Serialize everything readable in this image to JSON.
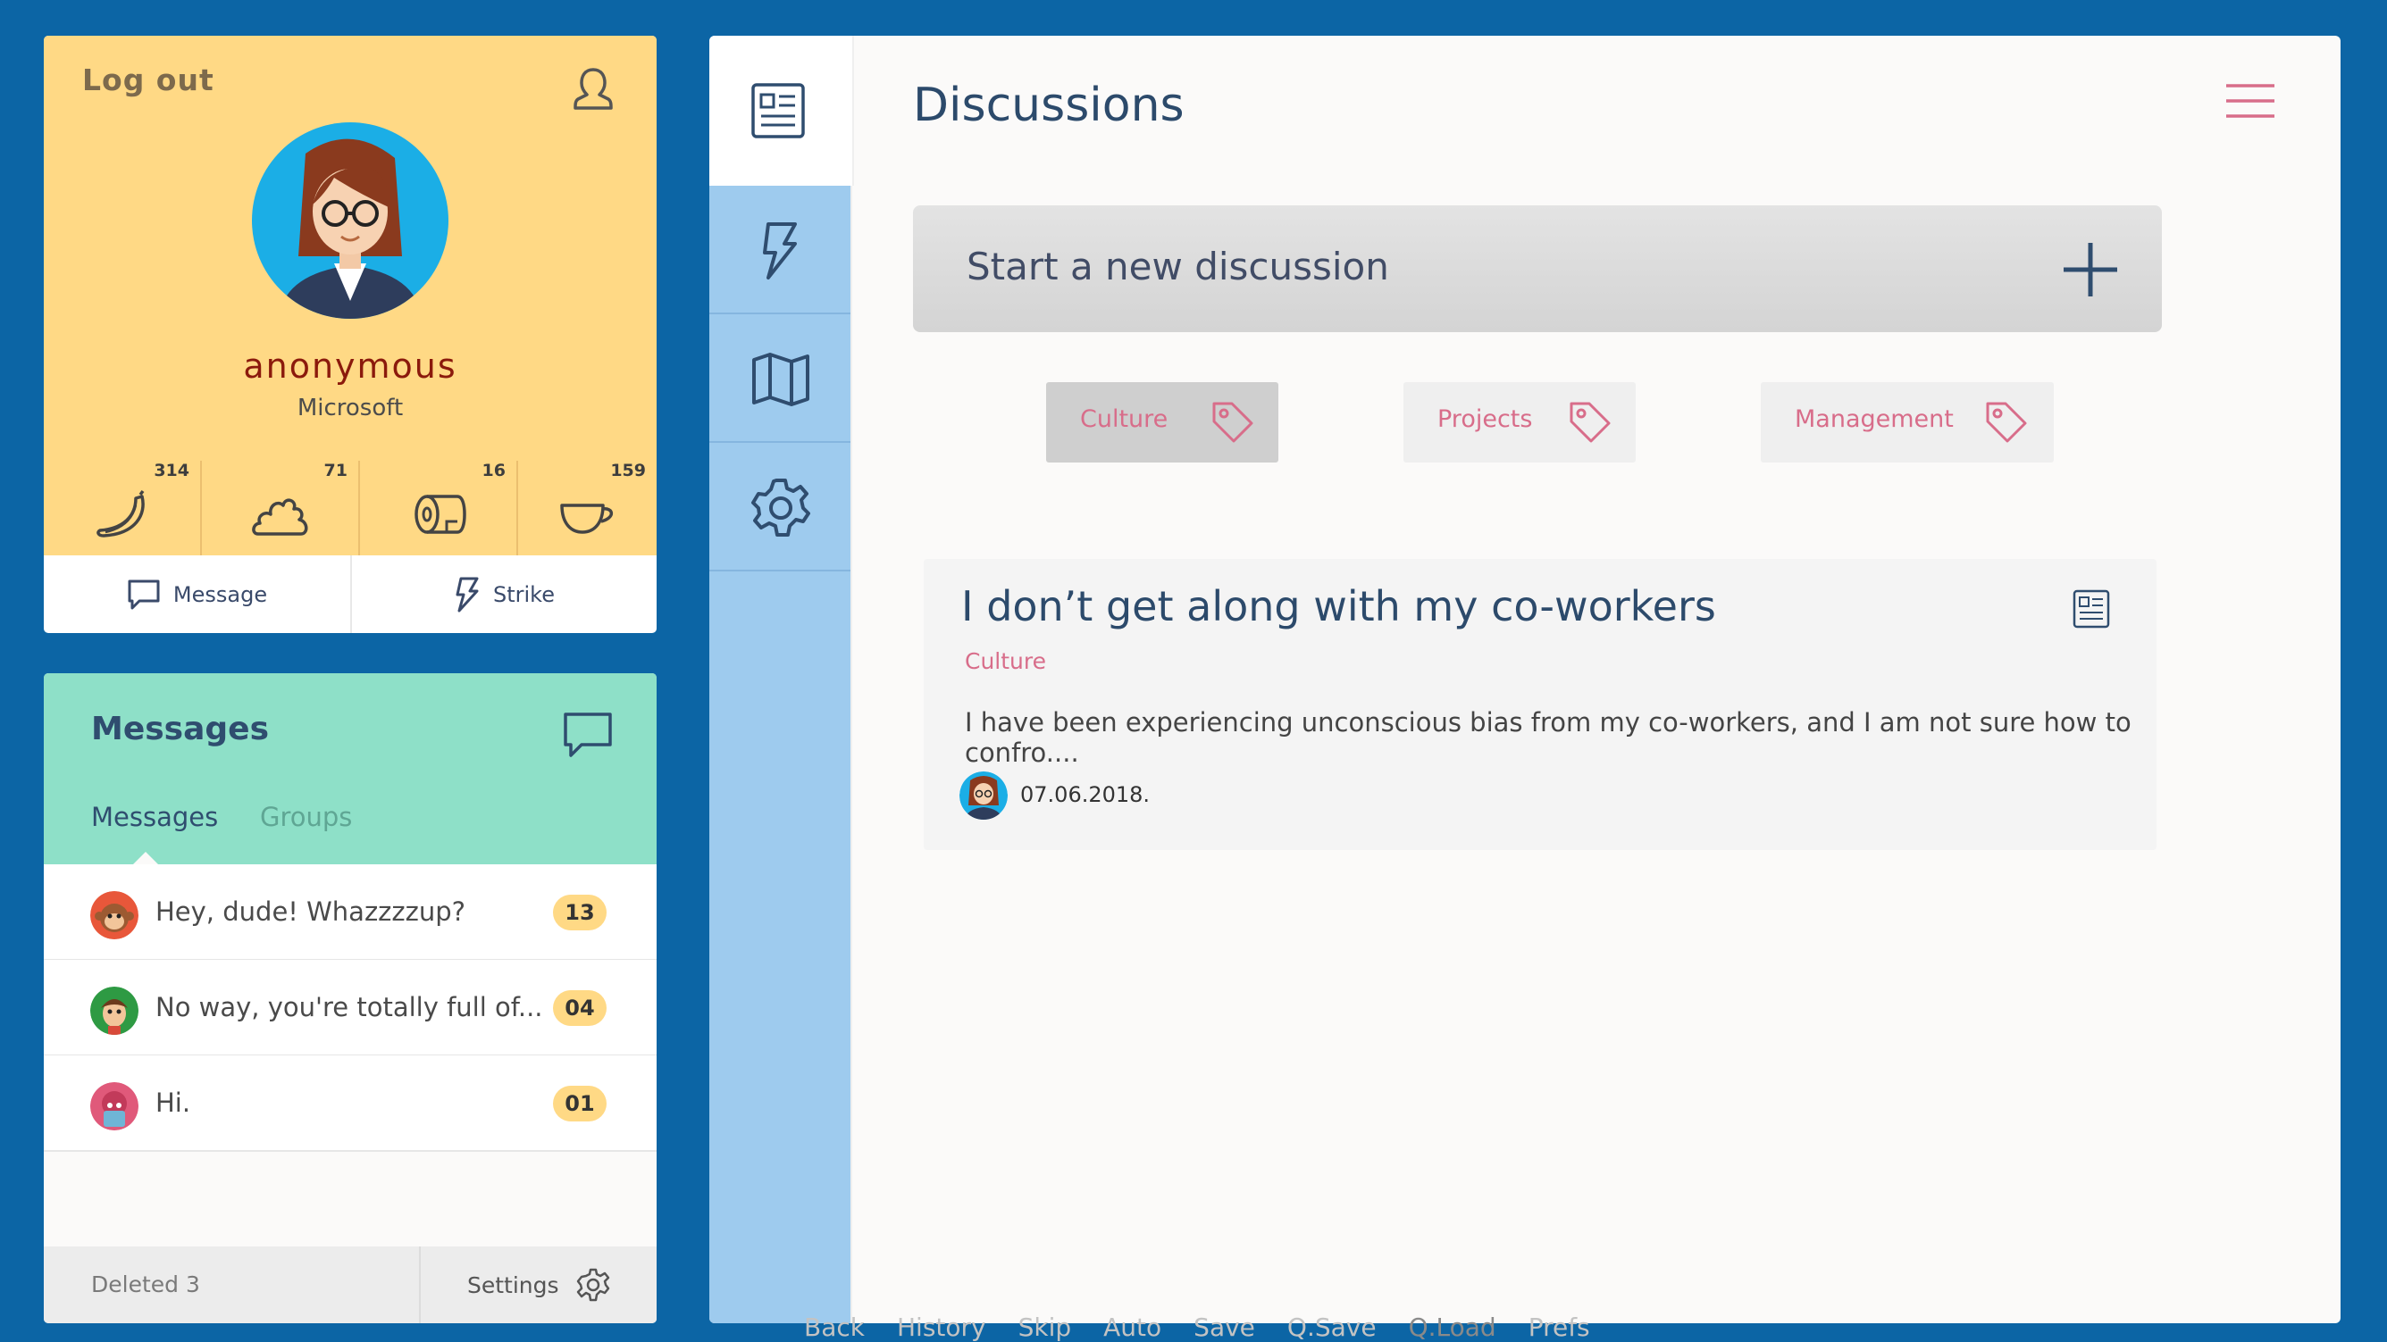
{
  "profile": {
    "logout_label": "Log out",
    "name": "anonymous",
    "company": "Microsoft",
    "stats": [
      {
        "icon": "banana-icon",
        "count": "314"
      },
      {
        "icon": "poop-icon",
        "count": "71"
      },
      {
        "icon": "toilet-paper-icon",
        "count": "16"
      },
      {
        "icon": "coffee-cup-icon",
        "count": "159"
      }
    ],
    "actions": {
      "message_label": "Message",
      "strike_label": "Strike"
    }
  },
  "messages": {
    "title": "Messages",
    "tabs": {
      "messages_label": "Messages",
      "groups_label": "Groups"
    },
    "items": [
      {
        "text": "Hey, dude! Whazzzzup?",
        "badge": "13"
      },
      {
        "text": "No way, you're totally full of...",
        "badge": "04"
      },
      {
        "text": "Hi.",
        "badge": "01"
      }
    ],
    "footer": {
      "deleted_label": "Deleted 3",
      "settings_label": "Settings"
    }
  },
  "main": {
    "title": "Discussions",
    "new_discussion_label": "Start a new discussion",
    "tags": [
      {
        "label": "Culture",
        "active": true
      },
      {
        "label": "Projects",
        "active": false
      },
      {
        "label": "Management",
        "active": false
      }
    ],
    "discussion": {
      "title": "I don’t get along with my co-workers",
      "tag": "Culture",
      "excerpt": "I have been experiencing unconscious bias from my co-workers, and I am not sure how to confro....",
      "date": "07.06.2018."
    }
  },
  "quick_menu": [
    "Back",
    "History",
    "Skip",
    "Auto",
    "Save",
    "Q.Save",
    "Q.Load",
    "Prefs"
  ],
  "colors": {
    "background": "#0c65a5",
    "profile_bg": "#ffd985",
    "messages_header_bg": "#8ee0c8",
    "rail_bg": "#9ecbee",
    "title_text": "#2c4a6b",
    "accent_pink": "#d86d8a"
  }
}
